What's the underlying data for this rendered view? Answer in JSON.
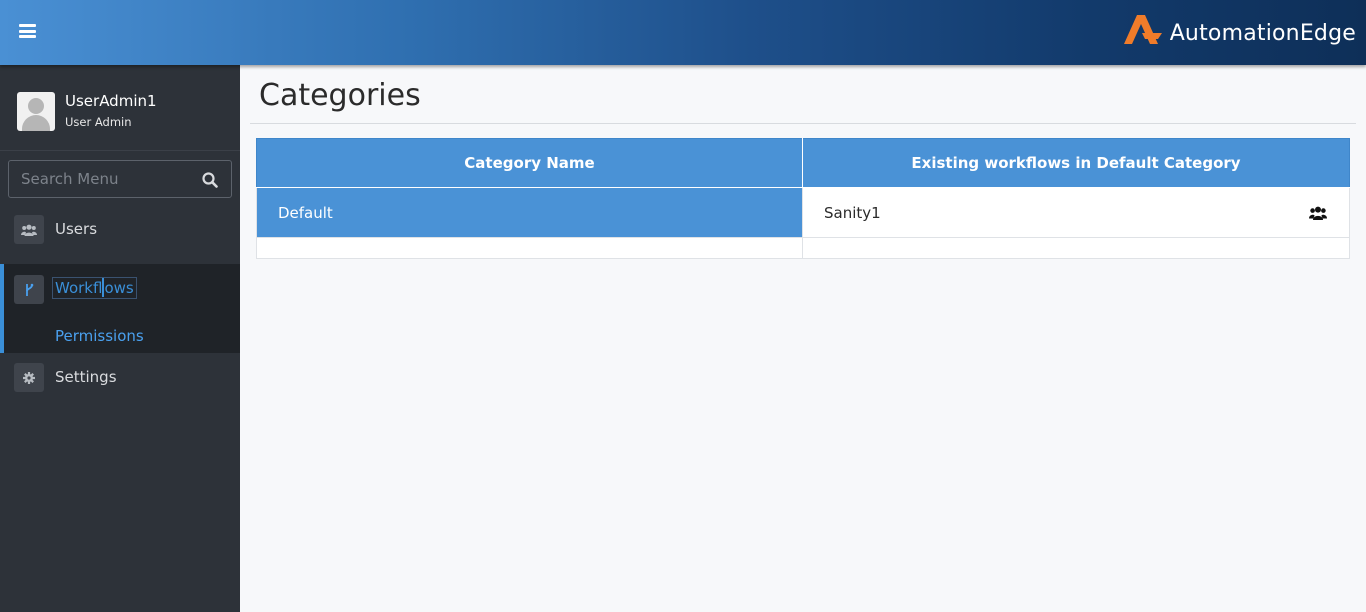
{
  "header": {
    "brand": "AutomationEdge",
    "brand_accent": "#f07c2a",
    "menu_toggle_icon": "hamburger-icon"
  },
  "sidebar": {
    "user": {
      "name": "UserAdmin1",
      "role": "User Admin"
    },
    "search": {
      "placeholder": "Search Menu",
      "icon": "search-icon"
    },
    "items": [
      {
        "label": "Users",
        "icon": "users-icon"
      },
      {
        "label": "Workflows",
        "icon": "workflow-icon",
        "active": true,
        "children": [
          {
            "label": "Permissions"
          }
        ]
      },
      {
        "label": "Settings",
        "icon": "gear-icon"
      }
    ],
    "active_color": "#3a8fd8"
  },
  "main": {
    "title": "Categories",
    "table": {
      "headers": [
        "Category Name",
        "Existing workflows in Default Category"
      ],
      "rows": [
        {
          "category": "Default",
          "workflow": "Sanity1",
          "selected": true
        }
      ]
    },
    "header_color": "#4a92d6"
  }
}
